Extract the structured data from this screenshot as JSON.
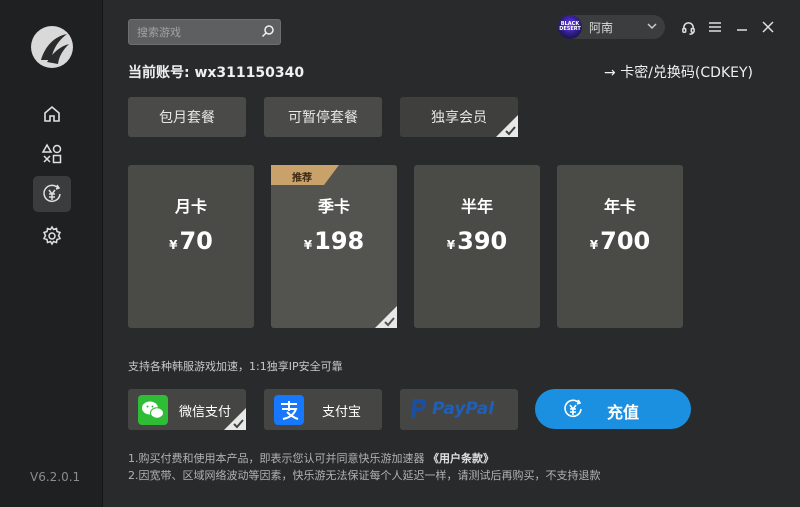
{
  "sidebar": {
    "version": "V6.2.0.1",
    "items": [
      {
        "icon": "home-icon"
      },
      {
        "icon": "games-icon"
      },
      {
        "icon": "recharge-icon",
        "active": true
      },
      {
        "icon": "gear-icon"
      }
    ]
  },
  "search": {
    "placeholder": "搜索游戏"
  },
  "user": {
    "avatar_text": "BLACK DESERT",
    "name": "阿南"
  },
  "account": {
    "label": "当前账号: wx311150340"
  },
  "cdkey": {
    "label": "→ 卡密/兑换码(CDKEY)"
  },
  "tabs": [
    {
      "label": "包月套餐"
    },
    {
      "label": "可暂停套餐"
    },
    {
      "label": "独享会员",
      "selected": true
    }
  ],
  "plans": [
    {
      "name": "月卡",
      "currency": "¥",
      "price": "70"
    },
    {
      "name": "季卡",
      "currency": "¥",
      "price": "198",
      "badge": "推荐",
      "selected": true
    },
    {
      "name": "半年",
      "currency": "¥",
      "price": "390"
    },
    {
      "name": "年卡",
      "currency": "¥",
      "price": "700"
    }
  ],
  "description": "支持各种韩服游戏加速，1:1独享IP安全可靠",
  "payments": [
    {
      "label": "微信支付",
      "selected": true
    },
    {
      "label": "支付宝"
    },
    {
      "label": "PayPal"
    }
  ],
  "charge": {
    "label": "充值"
  },
  "notes": {
    "line1_prefix": "1.购买付费和使用本产品，即表示您认可并同意快乐游加速器",
    "line1_link": "《用户条款》",
    "line2": "2.因宽带、区域网络波动等因素，快乐游无法保证每个人延迟一样，请测试后再购买，不支持退款"
  },
  "colors": {
    "accent": "#1b8fe0",
    "badge": "#c9a26b",
    "card": "#4a4b47",
    "sidebar": "#1f2022"
  }
}
